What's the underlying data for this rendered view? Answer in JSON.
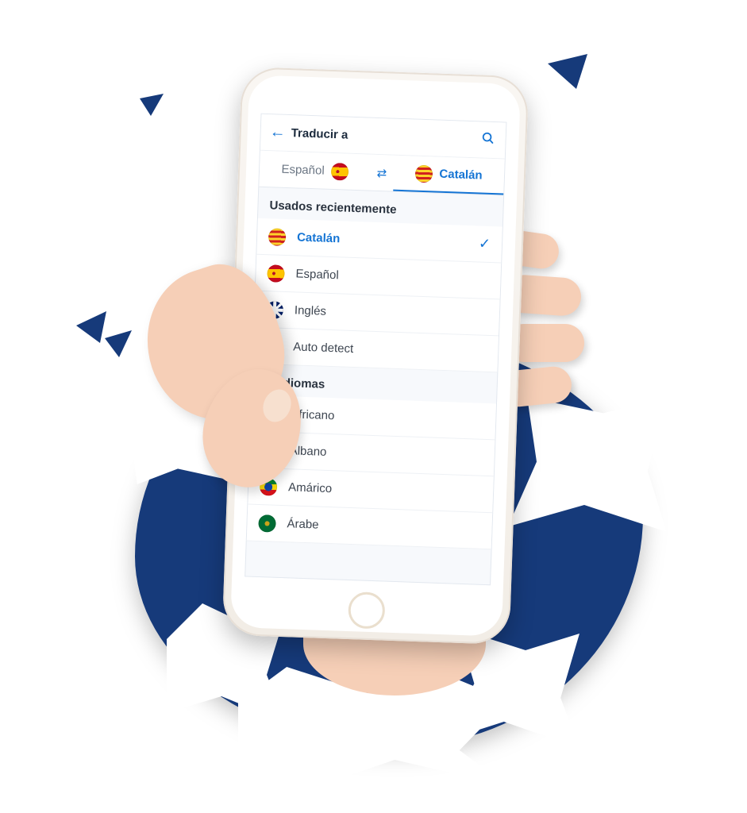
{
  "colors": {
    "accent": "#1474d4",
    "brand_dark": "#163a7a"
  },
  "header": {
    "title": "Traducir a"
  },
  "pair": {
    "source": {
      "label": "Español",
      "flag": "es"
    },
    "target": {
      "label": "Catalán",
      "flag": "ca"
    }
  },
  "sections": {
    "recent_title": "Usados recientemente",
    "all_title": "29 idiomas"
  },
  "recent": [
    {
      "label": "Catalán",
      "flag": "ca",
      "selected": true
    },
    {
      "label": "Español",
      "flag": "es",
      "selected": false
    },
    {
      "label": "Inglés",
      "flag": "gb",
      "selected": false
    },
    {
      "label": "Auto detect",
      "flag": "auto",
      "selected": false
    }
  ],
  "languages": [
    {
      "label": "Africano",
      "flag": "za"
    },
    {
      "label": "Albano",
      "flag": "al"
    },
    {
      "label": "Amárico",
      "flag": "et"
    },
    {
      "label": "Árabe",
      "flag": "ar"
    }
  ]
}
